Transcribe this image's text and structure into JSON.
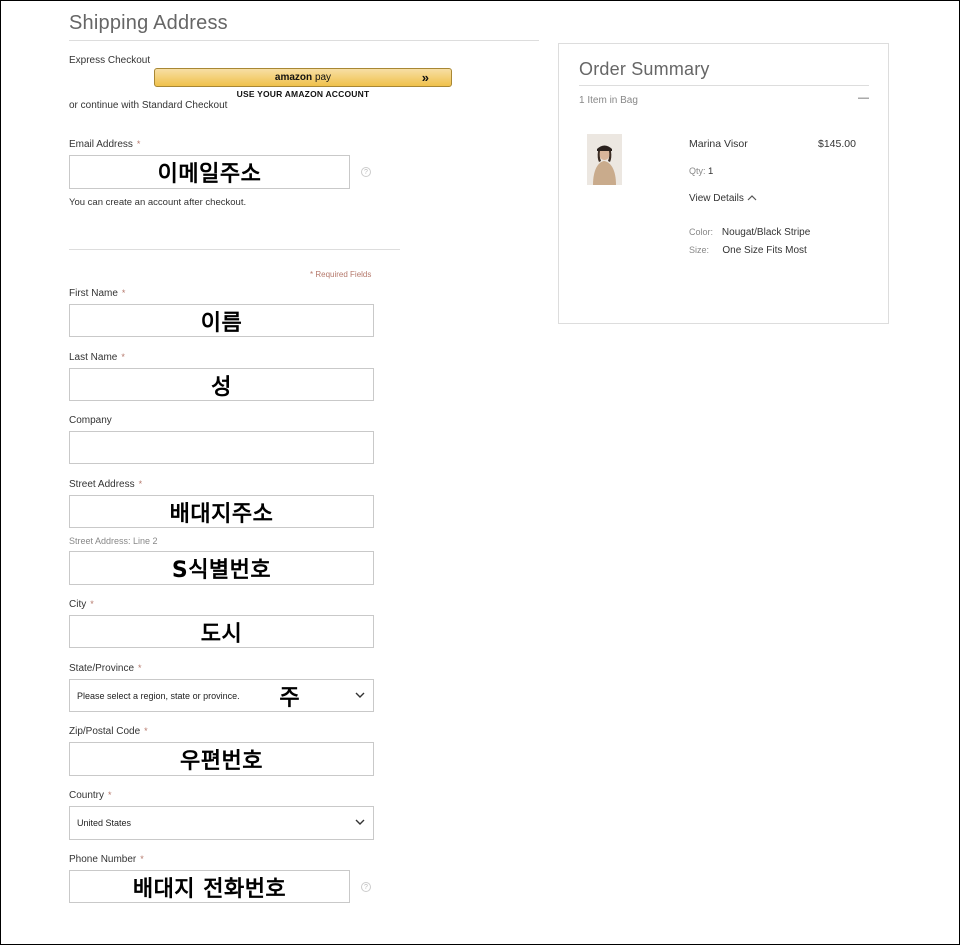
{
  "shipping": {
    "title": "Shipping Address",
    "express_label": "Express Checkout",
    "amazon_brand": "amazon",
    "amazon_pay": "pay",
    "amazon_arrows": "»",
    "amazon_sub": "USE YOUR AMAZON ACCOUNT",
    "or_continue": "or continue with Standard Checkout",
    "email": {
      "label": "Email Address",
      "req": "*",
      "overlay": "이메일주소",
      "help": "?"
    },
    "account_note": "You can create an account after checkout.",
    "required_note": "* Required Fields",
    "first_name": {
      "label": "First Name",
      "req": "*",
      "overlay": "이름"
    },
    "last_name": {
      "label": "Last Name",
      "req": "*",
      "overlay": "성"
    },
    "company": {
      "label": "Company"
    },
    "street": {
      "label": "Street Address",
      "req": "*",
      "overlay": "배대지주소"
    },
    "street2": {
      "label": "Street Address: Line 2",
      "overlay": "S식별번호"
    },
    "city": {
      "label": "City",
      "req": "*",
      "overlay": "도시"
    },
    "state": {
      "label": "State/Province",
      "req": "*",
      "value": "Please select a region, state or province.",
      "overlay": "주"
    },
    "zip": {
      "label": "Zip/Postal Code",
      "req": "*",
      "overlay": "우편번호"
    },
    "country": {
      "label": "Country",
      "req": "*",
      "value": "United States"
    },
    "phone": {
      "label": "Phone Number",
      "req": "*",
      "overlay": "배대지 전화번호",
      "help": "?"
    }
  },
  "summary": {
    "title": "Order Summary",
    "items_count": "1 Item in Bag",
    "collapse": "—",
    "item": {
      "name": "Marina Visor",
      "price": "$145.00",
      "qty_label": "Qty:",
      "qty": "1",
      "view_details": "View Details",
      "color_label": "Color:",
      "color_value": "Nougat/Black Stripe",
      "size_label": "Size:",
      "size_value": "One Size Fits Most"
    }
  }
}
